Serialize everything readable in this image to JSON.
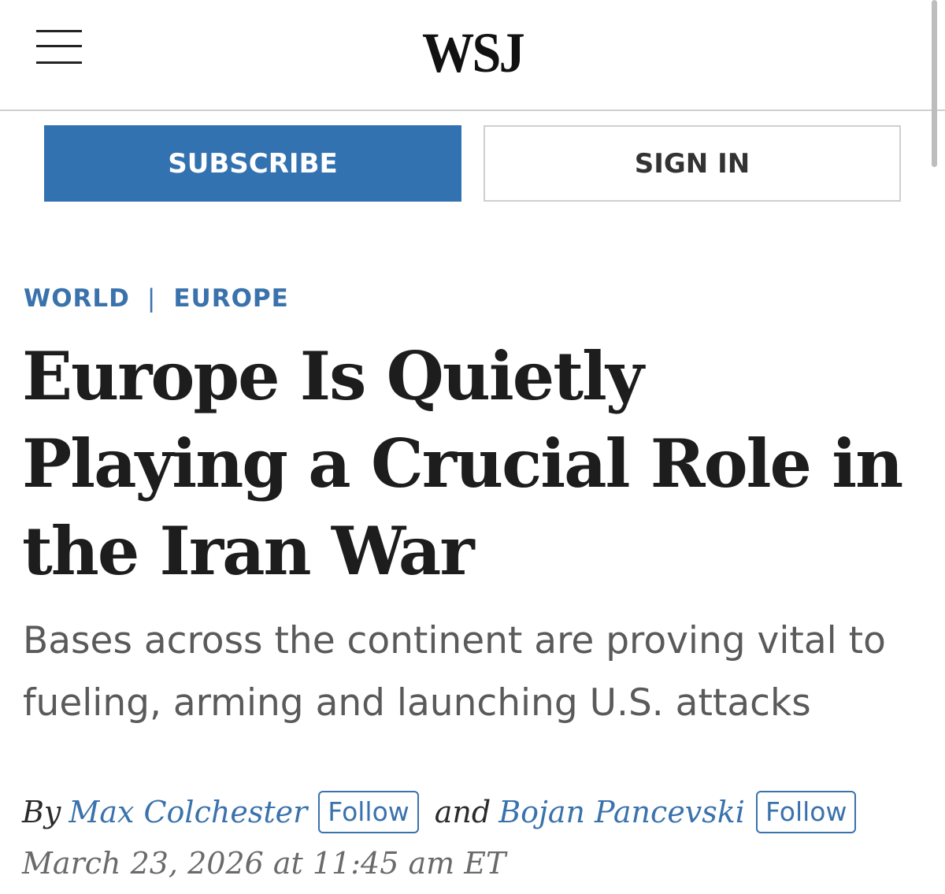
{
  "header": {
    "logo_text": "WSJ",
    "menu_icon": "hamburger-menu-icon"
  },
  "actions": {
    "subscribe_label": "SUBSCRIBE",
    "signin_label": "SIGN IN"
  },
  "breadcrumb": {
    "section": "WORLD",
    "separator": "|",
    "subsection": "EUROPE"
  },
  "article": {
    "headline": "Europe Is Quietly Playing a Crucial Role in the Iran War",
    "dek": "Bases across the continent are proving vital to fueling, arming and launching U.S. attacks",
    "byline": {
      "prefix": "By",
      "author1": "Max Colchester",
      "follow1": "Follow",
      "conjunction": "and",
      "author2": "Bojan Pancevski",
      "follow2": "Follow"
    },
    "timestamp": "March 23, 2026 at 11:45 am ET"
  },
  "colors": {
    "accent_blue": "#3372b1",
    "link_blue": "#3a72ac",
    "headline": "#1d1d1d",
    "dek": "#5a5a5a"
  }
}
